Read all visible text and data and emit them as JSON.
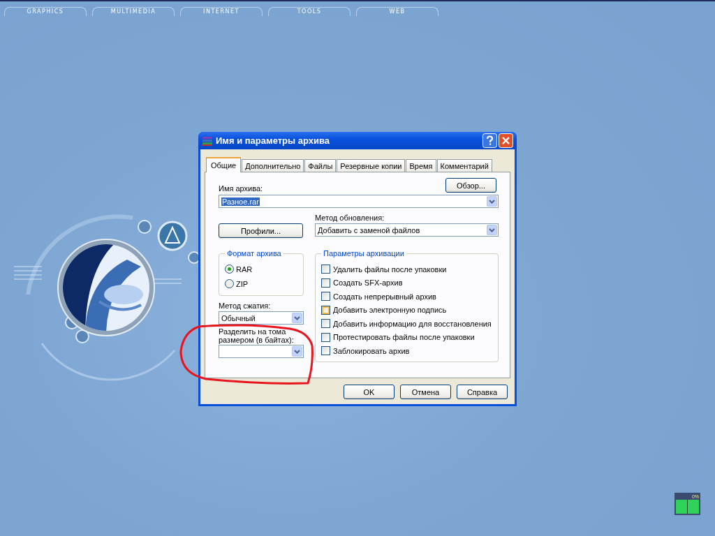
{
  "wallpaper_tabs": [
    "GRAPHICS",
    "MULTIMEDIA",
    "INTERNET",
    "TOOLS",
    "WEB"
  ],
  "dialog": {
    "title": "Имя и параметры архива",
    "tabs": [
      {
        "label": "Общие",
        "selected": true
      },
      {
        "label": "Дополнительно",
        "selected": false
      },
      {
        "label": "Файлы",
        "selected": false
      },
      {
        "label": "Резервные копии",
        "selected": false
      },
      {
        "label": "Время",
        "selected": false
      },
      {
        "label": "Комментарий",
        "selected": false
      }
    ],
    "archive_name": {
      "label": "Имя архива:",
      "value": "Разное.rar"
    },
    "browse_button": "Обзор...",
    "profiles_button": "Профили...",
    "update_method": {
      "label": "Метод обновления:",
      "value": "Добавить с заменой файлов"
    },
    "archive_format": {
      "title": "Формат архива",
      "options": [
        {
          "label": "RAR",
          "selected": true
        },
        {
          "label": "ZIP",
          "selected": false
        }
      ]
    },
    "compression_method": {
      "label": "Метод сжатия:",
      "value": "Обычный"
    },
    "split_volumes": {
      "label_lines": [
        "Разделить на тома",
        "размером (в байтах):"
      ]
    },
    "archive_options": {
      "title": "Параметры архивации",
      "items": [
        {
          "label": "Удалить файлы после упаковки",
          "checked": false,
          "hovered": false
        },
        {
          "label": "Создать SFX-архив",
          "checked": false,
          "hovered": false
        },
        {
          "label": "Создать непрерывный архив",
          "checked": false,
          "hovered": false
        },
        {
          "label": "Добавить электронную подпись",
          "checked": false,
          "hovered": true
        },
        {
          "label": "Добавить информацию для восстановления",
          "checked": false,
          "hovered": false
        },
        {
          "label": "Протестировать файлы после упаковки",
          "checked": false,
          "hovered": false
        },
        {
          "label": "Заблокировать архив",
          "checked": false,
          "hovered": false
        }
      ]
    },
    "buttons": [
      "OK",
      "Отмена",
      "Справка"
    ]
  },
  "cpu_meter": {
    "reading": "0%"
  }
}
